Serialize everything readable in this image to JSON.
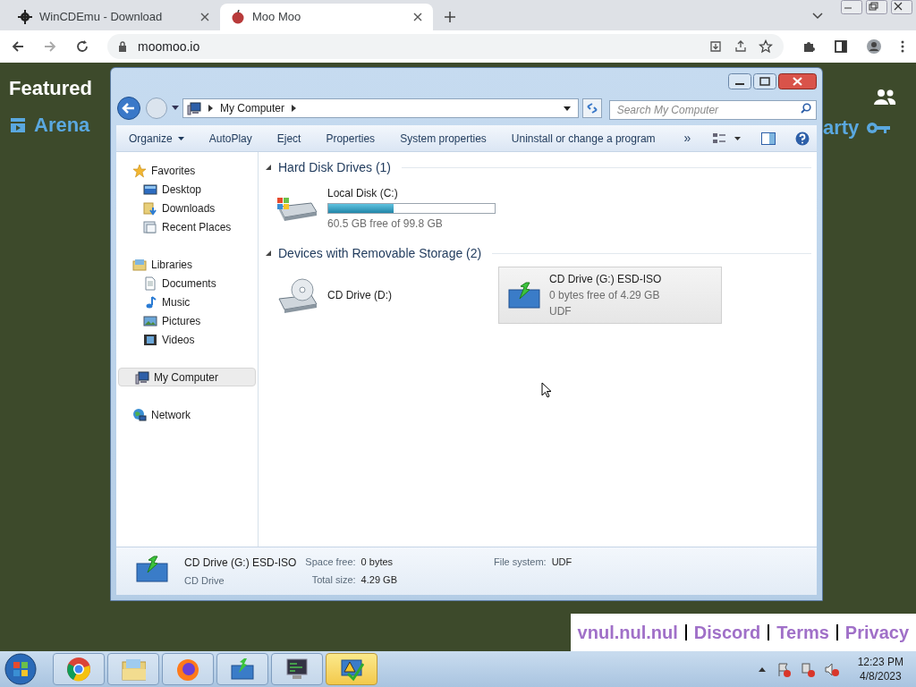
{
  "browser": {
    "tabs": [
      {
        "title": "WinCDEmu - Download",
        "kind": "gear",
        "selected": false
      },
      {
        "title": "Moo Moo",
        "kind": "apple",
        "selected": true
      }
    ],
    "address": "moomoo.io"
  },
  "page": {
    "featured": "Featured",
    "arena": "Arena",
    "party": "arty",
    "footer_links": [
      "vnul.nul.nul",
      "Discord",
      "Terms",
      "Privacy"
    ]
  },
  "explorer": {
    "breadcrumb": "My Computer",
    "search_placeholder": "Search My Computer",
    "commands": [
      "Organize",
      "AutoPlay",
      "Eject",
      "Properties",
      "System properties",
      "Uninstall or change a program"
    ],
    "more": "»",
    "nav": [
      {
        "label": "Favorites",
        "kind": "star",
        "selected": false,
        "children": [
          {
            "label": "Desktop",
            "kind": "desktop",
            "selected": false
          },
          {
            "label": "Downloads",
            "kind": "downloads",
            "selected": false
          },
          {
            "label": "Recent Places",
            "kind": "recent",
            "selected": false
          }
        ]
      },
      {
        "label": "Libraries",
        "kind": "libraries",
        "selected": false,
        "children": [
          {
            "label": "Documents",
            "kind": "document",
            "selected": false
          },
          {
            "label": "Music",
            "kind": "music",
            "selected": false
          },
          {
            "label": "Pictures",
            "kind": "pictures",
            "selected": false
          },
          {
            "label": "Videos",
            "kind": "videos",
            "selected": false
          }
        ]
      },
      {
        "label": "My Computer",
        "kind": "computer",
        "selected": true
      },
      {
        "label": "Network",
        "kind": "network",
        "selected": false
      }
    ],
    "sections": [
      {
        "title": "Hard Disk Drives (1)",
        "drives": [
          {
            "kind": "hdd",
            "name": "Local Disk (C:)",
            "level": 0.39,
            "detail": "60.5 GB free of 99.8 GB",
            "selected": false
          }
        ]
      },
      {
        "title": "Devices with Removable Storage (2)",
        "drives": [
          {
            "kind": "cd",
            "name": "CD Drive (D:)",
            "selected": false
          },
          {
            "kind": "iso",
            "name": "CD Drive (G:) ESD-ISO",
            "detail": "0 bytes free of 4.29 GB",
            "fs": "UDF",
            "selected": true
          }
        ]
      }
    ],
    "details": {
      "name": "CD Drive (G:) ESD-ISO",
      "type": "CD Drive",
      "fields": [
        {
          "label": "Space free:",
          "value": "0 bytes"
        },
        {
          "label": "Total size:",
          "value": "4.29 GB"
        },
        {
          "label": "File system:",
          "value": "UDF"
        }
      ]
    }
  },
  "taskbar": {
    "items": [
      {
        "kind": "chrome",
        "active": false
      },
      {
        "kind": "explorer",
        "active": false
      },
      {
        "kind": "firefox",
        "active": false
      },
      {
        "kind": "iso",
        "active": false
      },
      {
        "kind": "monitor",
        "active": false
      },
      {
        "kind": "check",
        "active": true
      }
    ],
    "time": "12:23 PM",
    "date": "4/8/2023"
  }
}
